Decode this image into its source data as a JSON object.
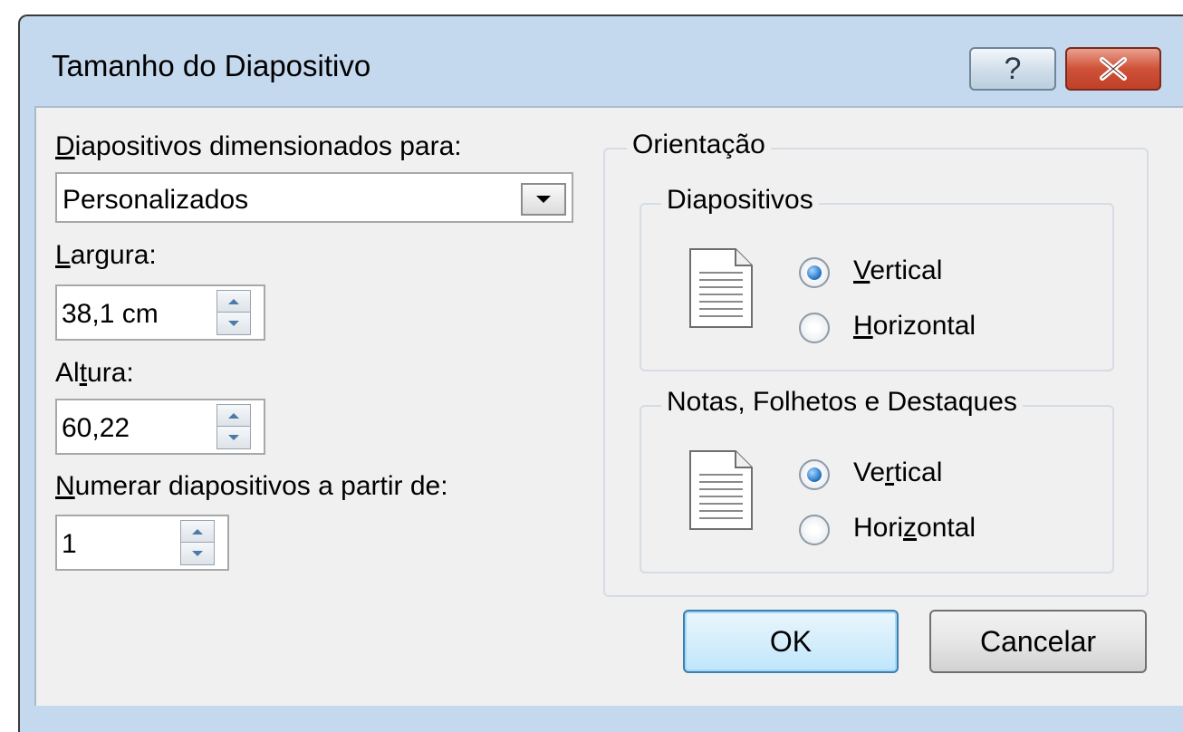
{
  "window": {
    "title": "Tamanho do Diapositivo",
    "help_glyph": "?",
    "close_icon": "close-x-icon"
  },
  "left": {
    "size_label": {
      "accel": "D",
      "rest": "iapositivos dimensionados para:"
    },
    "size_value": "Personalizados",
    "width_label": {
      "accel": "L",
      "rest": "argura:"
    },
    "width_value": "38,1 cm",
    "height_label": {
      "pre": "Al",
      "accel": "t",
      "rest": "ura:"
    },
    "height_value": "60,22",
    "number_label": {
      "accel": "N",
      "rest": "umerar diapositivos a partir de:"
    },
    "number_value": "1"
  },
  "orientation": {
    "legend": "Orientação",
    "slides": {
      "legend": "Diapositivos",
      "vertical": {
        "accel": "V",
        "rest": "ertical",
        "checked": true
      },
      "horizontal": {
        "accel": "H",
        "rest": "orizontal",
        "checked": false
      }
    },
    "notes": {
      "legend": "Notas, Folhetos e Destaques",
      "vertical": {
        "pre": "Ve",
        "accel": "r",
        "rest": "tical",
        "checked": true
      },
      "horizontal": {
        "pre": "Hori",
        "accel": "z",
        "rest": "ontal",
        "checked": false
      }
    }
  },
  "buttons": {
    "ok": "OK",
    "cancel": "Cancelar"
  },
  "colors": {
    "title_bar": "#c4d9ee",
    "client": "#f0f0f0",
    "close_button": "#c94b33",
    "ok_border": "#3c7fb1"
  }
}
